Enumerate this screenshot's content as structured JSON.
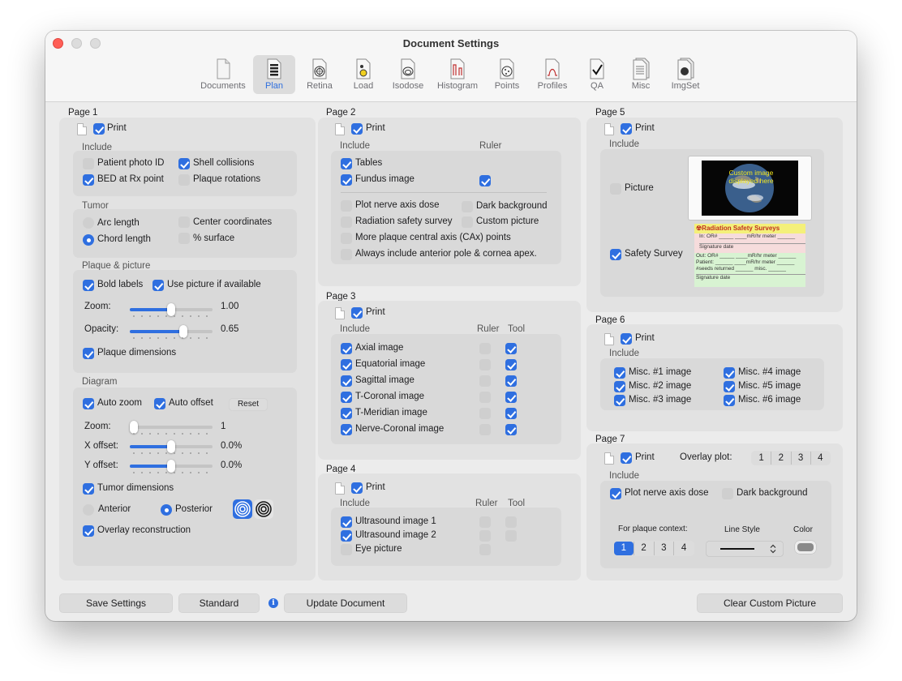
{
  "window": {
    "title": "Document Settings"
  },
  "toolbar": [
    {
      "label": "Documents",
      "icon": "documents-icon",
      "selected": false
    },
    {
      "label": "Plan",
      "icon": "plan-icon",
      "selected": true
    },
    {
      "label": "Retina",
      "icon": "retina-icon",
      "selected": false
    },
    {
      "label": "Load",
      "icon": "load-icon",
      "selected": false
    },
    {
      "label": "Isodose",
      "icon": "isodose-icon",
      "selected": false
    },
    {
      "label": "Histogram",
      "icon": "histogram-icon",
      "selected": false
    },
    {
      "label": "Points",
      "icon": "points-icon",
      "selected": false
    },
    {
      "label": "Profiles",
      "icon": "profiles-icon",
      "selected": false
    },
    {
      "label": "QA",
      "icon": "qa-icon",
      "selected": false
    },
    {
      "label": "Misc",
      "icon": "misc-icon",
      "selected": false
    },
    {
      "label": "ImgSet",
      "icon": "imgset-icon",
      "selected": false
    }
  ],
  "page1": {
    "title": "Page 1",
    "print": "Print",
    "include": "Include",
    "patient_photo": "Patient photo ID",
    "shell_collisions": "Shell collisions",
    "bed_rx": "BED at Rx point",
    "plaque_rotations": "Plaque rotations",
    "tumor": "Tumor",
    "arc_length": "Arc length",
    "center_coords": "Center coordinates",
    "chord_length": "Chord length",
    "pct_surface": "% surface",
    "plaque_picture": "Plaque & picture",
    "bold_labels": "Bold labels",
    "use_picture": "Use picture if available",
    "zoom_label": "Zoom:",
    "zoom_value": "1.00",
    "zoom_level": 0.5,
    "opacity_label": "Opacity:",
    "opacity_value": "0.65",
    "opacity_level": 0.65,
    "plaque_dims": "Plaque dimensions",
    "diagram": "Diagram",
    "auto_zoom": "Auto zoom",
    "auto_offset": "Auto offset",
    "reset": "Reset",
    "d_zoom_label": "Zoom:",
    "d_zoom_value": "1",
    "d_zoom_level": 0.0,
    "x_offset_label": "X offset:",
    "x_offset_value": "0.0%",
    "x_offset_level": 0.5,
    "y_offset_label": "Y offset:",
    "y_offset_value": "0.0%",
    "y_offset_level": 0.5,
    "tumor_dims": "Tumor dimensions",
    "anterior": "Anterior",
    "posterior": "Posterior",
    "overlay_recon": "Overlay reconstruction"
  },
  "page2": {
    "title": "Page 2",
    "print": "Print",
    "include": "Include",
    "ruler": "Ruler",
    "tables": "Tables",
    "fundus": "Fundus image",
    "plot_nerve": "Plot nerve axis dose",
    "dark_bg": "Dark background",
    "radiation_survey": "Radiation safety survey",
    "custom_picture": "Custom picture",
    "more_cax": "More plaque central axis (CAx) points",
    "anterior_pole": "Always include anterior pole & cornea apex."
  },
  "page3": {
    "title": "Page 3",
    "print": "Print",
    "include": "Include",
    "ruler": "Ruler",
    "tool": "Tool",
    "items": [
      "Axial image",
      "Equatorial image",
      "Sagittal image",
      "T-Coronal image",
      "T-Meridian image",
      "Nerve-Coronal image"
    ]
  },
  "page4": {
    "title": "Page 4",
    "print": "Print",
    "include": "Include",
    "ruler": "Ruler",
    "tool": "Tool",
    "items": [
      "Ultrasound image 1",
      "Ultrasound image 2",
      "Eye picture"
    ]
  },
  "page5": {
    "title": "Page 5",
    "print": "Print",
    "include": "Include",
    "picture": "Picture",
    "safety_survey": "Safety Survey",
    "preview_text": "Custom image displayed here",
    "survey": {
      "title": "Radiation Safety Surveys",
      "row_in": "In: OR# _____ ____mR/hr   meter ______",
      "sig1": "Signature                    date",
      "row_out": "Out: OR# _____ ____mR/hr   meter ______",
      "row_patient": "Patient: ______ ____mR/hr   meter ______",
      "row_seeds": "#seeds returned ______   misc. ______",
      "sig2": "Signature                    date"
    }
  },
  "page6": {
    "title": "Page 6",
    "print": "Print",
    "include": "Include",
    "items": [
      "Misc. #1 image",
      "Misc. #4 image",
      "Misc. #2 image",
      "Misc. #5 image",
      "Misc. #3 image",
      "Misc. #6 image"
    ]
  },
  "page7": {
    "title": "Page 7",
    "print": "Print",
    "overlay_plot": "Overlay plot:",
    "overlay_options": [
      "1",
      "2",
      "3",
      "4"
    ],
    "include": "Include",
    "plot_nerve": "Plot nerve axis dose",
    "dark_bg": "Dark background",
    "plaque_context": "For plaque context:",
    "context_options": [
      "1",
      "2",
      "3",
      "4"
    ],
    "line_style": "Line Style",
    "color": "Color"
  },
  "bottom": {
    "save": "Save Settings",
    "standard": "Standard",
    "update": "Update Document",
    "clear": "Clear Custom Picture"
  },
  "colors": {
    "accent": "#2f6fe0",
    "close": "#ff5f57"
  }
}
